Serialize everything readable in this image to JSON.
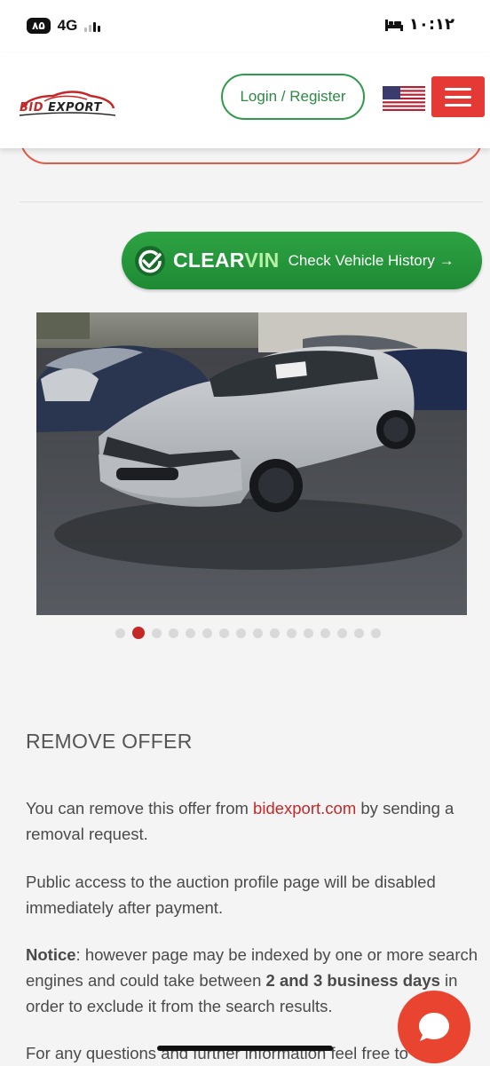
{
  "status_bar": {
    "battery": "۸۵",
    "network": "4G",
    "time": "۱۰:۱۲"
  },
  "header": {
    "logo": {
      "word1": "BID",
      "word2": "EXPORT"
    },
    "login_label": "Login / Register",
    "language_flag": "us-flag-icon",
    "menu_icon": "hamburger-menu-icon"
  },
  "clearvin": {
    "brand_part1": "CLEAR",
    "brand_part2": "VIN",
    "text": "Check Vehicle History",
    "arrow": "→",
    "icon": "check-circle-icon"
  },
  "gallery": {
    "photo": "silver-sedan-photo",
    "total_images": 16,
    "active_index": 1
  },
  "remove_offer": {
    "title": "REMOVE OFFER",
    "p1_before": "You can remove this offer from ",
    "p1_link": "bidexport.com",
    "p1_after": " by sending a removal request.",
    "p2": "Public access to the auction profile page will be disabled immediately after payment.",
    "p3_label": "Notice",
    "p3_a": ": however page may be indexed by one or more search engines and could take between ",
    "p3_bold": "2 and 3 business days",
    "p3_b": " in order to exclude it from the search results.",
    "p4": "For any questions and further information feel free to"
  },
  "colors": {
    "accent_red": "#e53935",
    "link_red": "#c62828",
    "green": "#2e9a4a"
  }
}
